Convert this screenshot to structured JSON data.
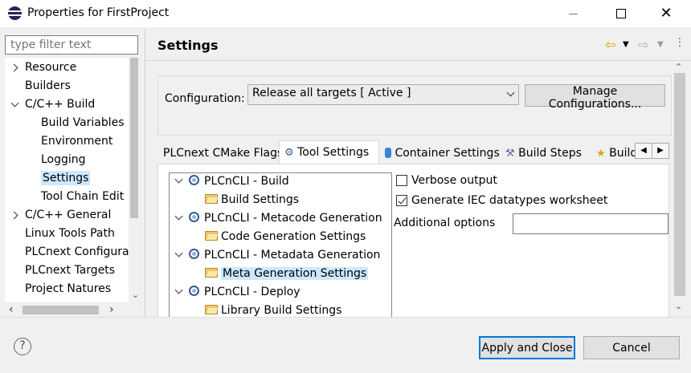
{
  "window": {
    "title": "Properties for FirstProject",
    "minimize": "",
    "maximize": "",
    "close": "✕"
  },
  "nav": {
    "filter_placeholder": "type filter text",
    "items": [
      {
        "label": "Resource",
        "level": 0,
        "expander": "collapsed"
      },
      {
        "label": "Builders",
        "level": 0,
        "expander": "none"
      },
      {
        "label": "C/C++ Build",
        "level": 0,
        "expander": "expanded"
      },
      {
        "label": "Build Variables",
        "level": 1,
        "expander": "none"
      },
      {
        "label": "Environment",
        "level": 1,
        "expander": "none"
      },
      {
        "label": "Logging",
        "level": 1,
        "expander": "none"
      },
      {
        "label": "Settings",
        "level": 1,
        "expander": "none",
        "selected": true
      },
      {
        "label": "Tool Chain Edit",
        "level": 1,
        "expander": "none"
      },
      {
        "label": "C/C++ General",
        "level": 0,
        "expander": "collapsed"
      },
      {
        "label": "Linux Tools Path",
        "level": 0,
        "expander": "none"
      },
      {
        "label": "PLCnext Configura",
        "level": 0,
        "expander": "none"
      },
      {
        "label": "PLCnext Targets",
        "level": 0,
        "expander": "none"
      },
      {
        "label": "Project Natures",
        "level": 0,
        "expander": "none"
      }
    ]
  },
  "page": {
    "heading": "Settings"
  },
  "config": {
    "label": "Configuration:",
    "selected": "Release all targets  [ Active ]",
    "manage_label": "Manage Configurations..."
  },
  "tabs": [
    {
      "label": "PLCnext CMake Flags",
      "icon": "none"
    },
    {
      "label": "Tool Settings",
      "icon": "gear-icon",
      "active": true
    },
    {
      "label": "Container Settings",
      "icon": "container-icon"
    },
    {
      "label": "Build Steps",
      "icon": "hammer-icon"
    },
    {
      "label": "Build",
      "icon": "trophy-icon"
    }
  ],
  "tool_tree": [
    {
      "label": "PLCnCLI - Build",
      "type": "tool"
    },
    {
      "label": "Build Settings",
      "type": "setting"
    },
    {
      "label": "PLCnCLI - Metacode Generation",
      "type": "tool"
    },
    {
      "label": "Code Generation Settings",
      "type": "setting"
    },
    {
      "label": "PLCnCLI - Metadata Generation",
      "type": "tool"
    },
    {
      "label": "Meta Generation Settings",
      "type": "setting",
      "selected": true
    },
    {
      "label": "PLCnCLI - Deploy",
      "type": "tool"
    },
    {
      "label": "Library Build Settings",
      "type": "setting"
    }
  ],
  "options": {
    "verbose_label": "Verbose output",
    "verbose_checked": false,
    "iec_label": "Generate IEC datatypes worksheet",
    "iec_checked": true,
    "additional_label": "Additional options",
    "additional_value": ""
  },
  "buttons": {
    "help": "?",
    "apply_close": "Apply and Close",
    "cancel": "Cancel"
  },
  "colors": {
    "selection": "#cce8ff",
    "primary_border": "#0078d7"
  }
}
